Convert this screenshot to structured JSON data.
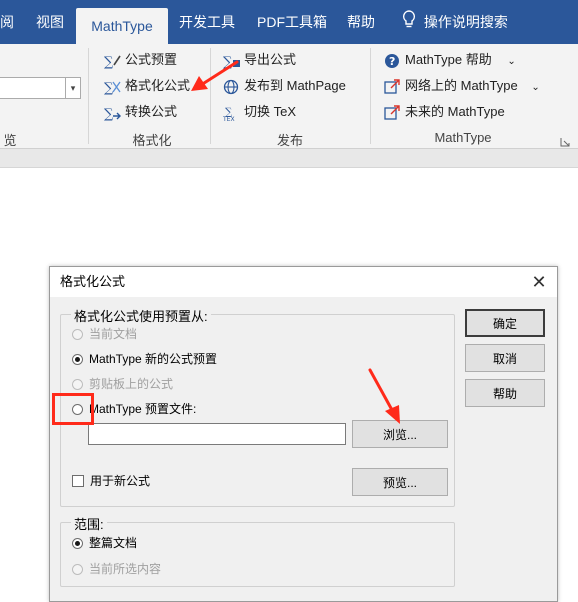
{
  "ribbon": {
    "tabs": [
      {
        "label": "阅"
      },
      {
        "label": "视图"
      },
      {
        "label": "MathType"
      },
      {
        "label": "开发工具"
      },
      {
        "label": "PDF工具箱"
      },
      {
        "label": "帮助"
      }
    ],
    "tell_me": "操作说明搜索",
    "left_group_label": "览",
    "format_group": {
      "items": [
        "公式预置",
        "格式化公式",
        "转换公式"
      ],
      "label": "格式化"
    },
    "publish_group": {
      "items": [
        "导出公式",
        "发布到 MathPage",
        "切换 TeX"
      ],
      "label": "发布"
    },
    "mathtype_group": {
      "items": [
        "MathType 帮助",
        "网络上的 MathType",
        "未来的 MathType"
      ],
      "label": "MathType"
    }
  },
  "dialog": {
    "title": "格式化公式",
    "close_glyph": "✕",
    "source_group": {
      "legend": "格式化公式使用预置从:",
      "options": [
        {
          "label": "当前文档",
          "checked": false,
          "disabled": true
        },
        {
          "label": "MathType 新的公式预置",
          "checked": true,
          "disabled": false
        },
        {
          "label": "剪贴板上的公式",
          "checked": false,
          "disabled": true
        },
        {
          "label": "MathType 预置文件:",
          "checked": false,
          "disabled": false
        }
      ],
      "file_path_value": "",
      "browse_button": "浏览...",
      "new_equations_checkbox": "用于新公式",
      "preview_button": "预览..."
    },
    "range_group": {
      "legend": "范围:",
      "options": [
        {
          "label": "整篇文档",
          "checked": true,
          "disabled": false
        },
        {
          "label": "当前所选内容",
          "checked": false,
          "disabled": true
        }
      ]
    },
    "buttons": {
      "ok": "确定",
      "cancel": "取消",
      "help": "帮助"
    }
  },
  "colors": {
    "ribbon_blue": "#2b579a",
    "annotation_red": "#ff2a1a"
  },
  "icons": [
    "lightbulb-icon",
    "dropdown-arrow-icon",
    "chevron-down-icon",
    "help-circle-icon",
    "globe-icon",
    "close-icon"
  ]
}
